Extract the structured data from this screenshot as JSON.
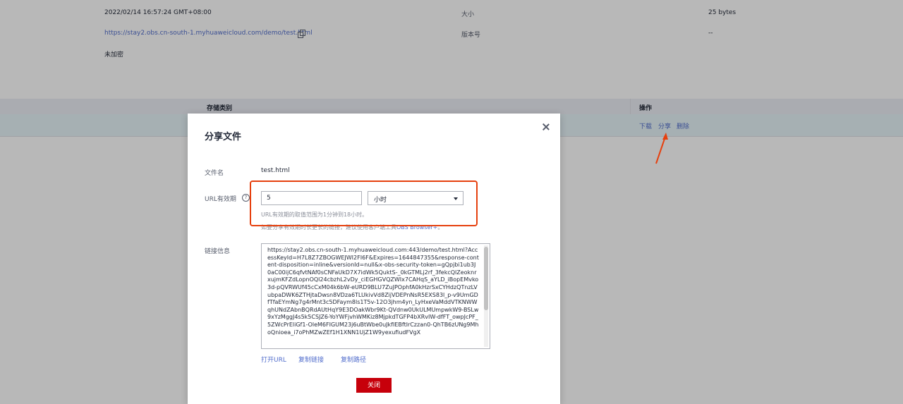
{
  "background": {
    "timestamp": "2022/02/14 16:57:24 GMT+08:00",
    "url": "https://stay2.obs.cn-south-1.myhuaweicloud.com/demo/test.html",
    "encryption": "未加密",
    "size_label": "大小",
    "size_value": "25 bytes",
    "version_label": "版本号",
    "version_value": "--",
    "table": {
      "col_storage": "存储类别",
      "col_ops": "操作",
      "op_download": "下载",
      "op_share": "分享",
      "op_delete": "删除"
    }
  },
  "dialog": {
    "title": "分享文件",
    "file_name_label": "文件名",
    "file_name_value": "test.html",
    "url_validity_label": "URL有效期",
    "help_icon_text": "?",
    "validity_value": "5",
    "validity_unit": "小时",
    "validity_hint": "URL有效期的取值范围为1分钟到18小时。",
    "long_link_hint": "如要分享有效期时长更长的链接，建议使用客户端工具",
    "long_link_tool": "OBS Browser+",
    "long_link_hint_end": "。",
    "link_info_label": "链接信息",
    "link_text": "https://stay2.obs.cn-south-1.myhuaweicloud.com:443/demo/test.html?AccessKeyId=H7L8Z7ZBOGWEJWI2FI6F&Expires=1644847355&response-content-disposition=inline&versionId=null&x-obs-security-token=gQpjbi1ub3J0aC00ijC6qfvtNAf0sCNFaUkD7X7idWk5QuktS-_0kGTMLj2rf_3fekcQlZeoknrxujmKFZdLopnOQl24cbzhL2vDy_ciEGHGVQZWIx7CAHqS_aYLD_iBopEMvko3d-pQVRWUf45cCxM04k6bW-eURD9BLU7ZuJPOphfA0kHzrSxCYHdzQTnzLVubpaDWK6ZTHjtaDwsn8VDza6TLUkivVd8ZijVDEPnNsR5EXS83l_p-v9UmGDfTfaEYmNg7g4rMnt3c5DFaym8ls1T5v-12O3jhm4yn_LyHxeVaMddVTKNWWqhUNdZAbnBQRdAUtHqY9E3DOakWbr9Kt-QVdnw0UkULMUmpwkW9-BSLw9xYzMggJ4s5k5CSJZ6-YoYWFjvhWMKiz8MjpkdTGFP4bXRvIW-dfFT_owpJcPF_5ZWcPrEliGf1-OleM6FIGUM23j6uBtWbe0uJkfIEBftlrCzzan0-QhTB6zUNg9MhoQnioea_i7oPhMZwZEf1H1XNN1UjZ1W9yexufiudFVgX",
    "open_url": "打开URL",
    "copy_link": "复制链接",
    "copy_path": "复制路径",
    "close_button": "关闭"
  },
  "colors": {
    "brand_red": "#c7000b",
    "highlight_box": "#e6400e",
    "link_blue": "#526ecc"
  }
}
